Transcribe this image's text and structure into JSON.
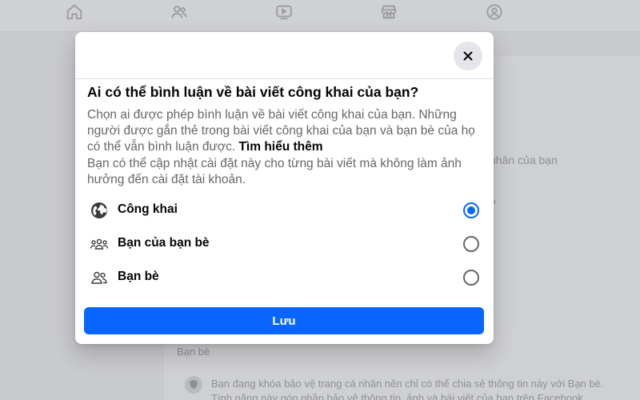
{
  "background": {
    "nav_icons": [
      "home-icon",
      "friends-icon",
      "video-icon",
      "marketplace-icon",
      "groups-icon"
    ],
    "fragment_profile": "nhân của bạn",
    "fragment_question": "?",
    "fragment_friends": "Bạn bè",
    "notice_line1": "Bạn đang khóa bảo vệ trang cá nhân nên chỉ có thể chia sẻ thông tin này với Bạn bè.",
    "notice_line2": "Tính năng này góp phần bảo vệ thông tin, ảnh và bài viết của bạn trên Facebook."
  },
  "modal": {
    "close_icon": "close-icon",
    "title": "Ai có thể bình luận về bài viết công khai của bạn?",
    "description": "Chọn ai được phép bình luận về bài viết công khai của bạn. Những người được gắn thẻ trong bài viết công khai của bạn và bạn bè của họ có thể vẫn bình luận được.",
    "learn_more": "Tìm hiểu thêm",
    "note": "Bạn có thể cập nhật cài đặt này cho từng bài viết mà không làm ảnh hưởng đến cài đặt tài khoản.",
    "options": [
      {
        "label": "Công khai",
        "icon": "globe-icon",
        "selected": true
      },
      {
        "label": "Bạn của bạn bè",
        "icon": "friends-of-friends-icon",
        "selected": false
      },
      {
        "label": "Bạn bè",
        "icon": "friends-icon",
        "selected": false
      }
    ],
    "save_label": "Lưu"
  },
  "colors": {
    "accent": "#0866ff",
    "overlay": "#c9cacd",
    "secondary_text": "#65676b"
  }
}
